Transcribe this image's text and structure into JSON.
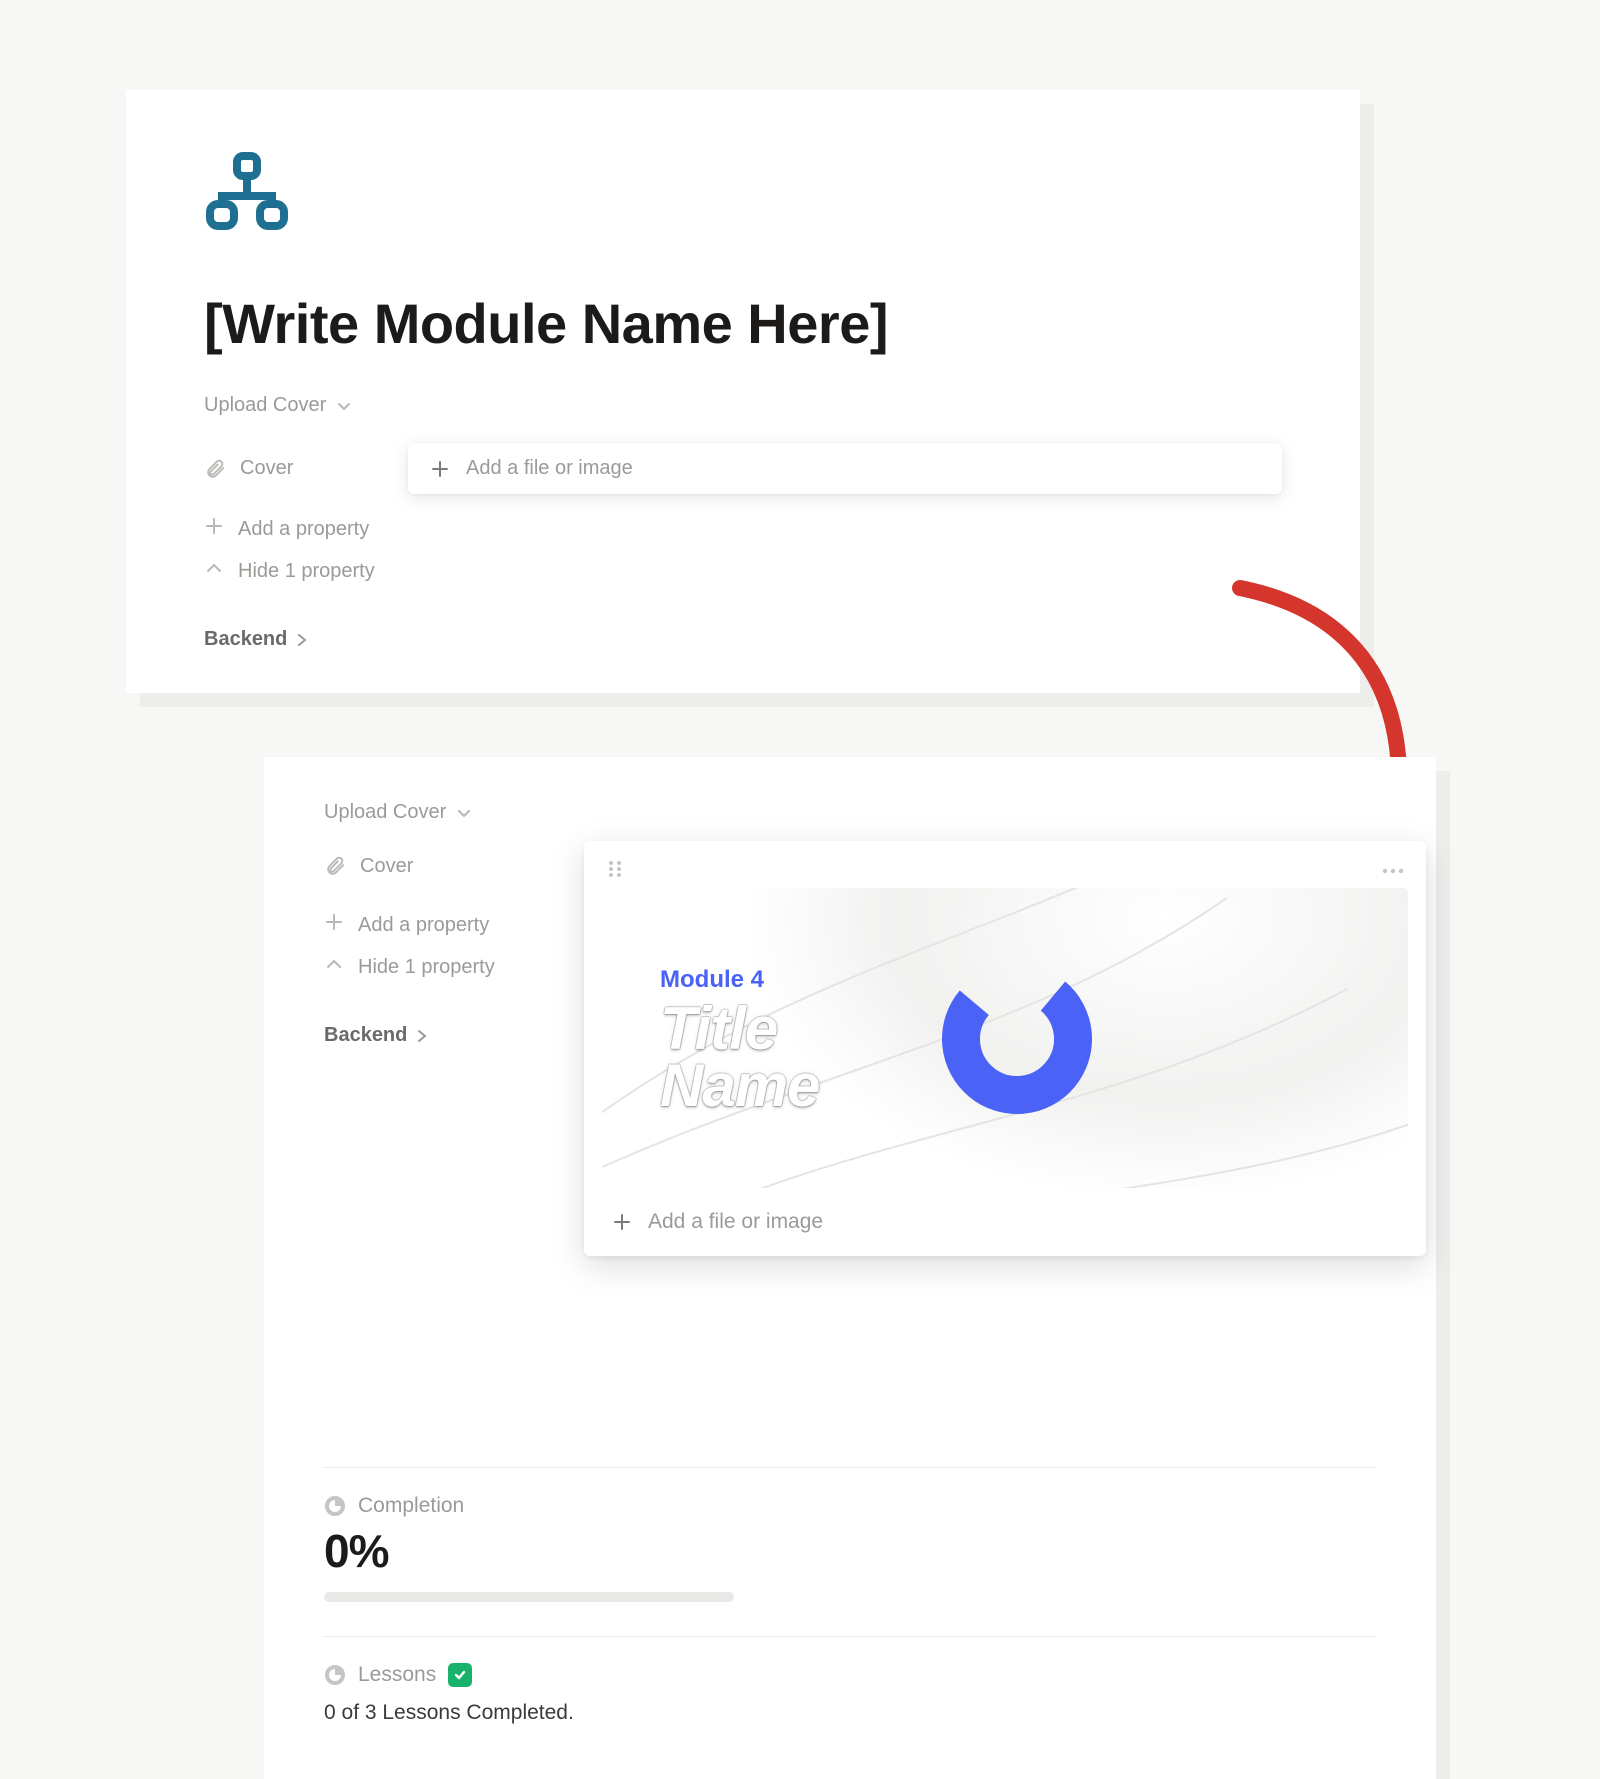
{
  "colors": {
    "accent_blue": "#4a62f5",
    "icon_teal": "#1f6f93",
    "arrow_red": "#d4362e",
    "check_green": "#18b26b"
  },
  "card1": {
    "page_title": "[Write Module Name Here]",
    "upload_cover_label": "Upload Cover",
    "cover_label": "Cover",
    "add_file_label": "Add a file or image",
    "add_property_label": "Add a property",
    "hide_property_label": "Hide 1 property",
    "backend_label": "Backend"
  },
  "card2": {
    "upload_cover_label": "Upload Cover",
    "cover_label": "Cover",
    "add_property_label": "Add a property",
    "hide_property_label": "Hide 1 property",
    "backend_label": "Backend",
    "module_tag": "Module 4",
    "title_line1": "Title",
    "title_line2": "Name",
    "add_file_label": "Add a file or image",
    "completion_label": "Completion",
    "completion_value": "0%",
    "lessons_label": "Lessons",
    "lessons_text": "0 of 3 Lessons Completed."
  }
}
